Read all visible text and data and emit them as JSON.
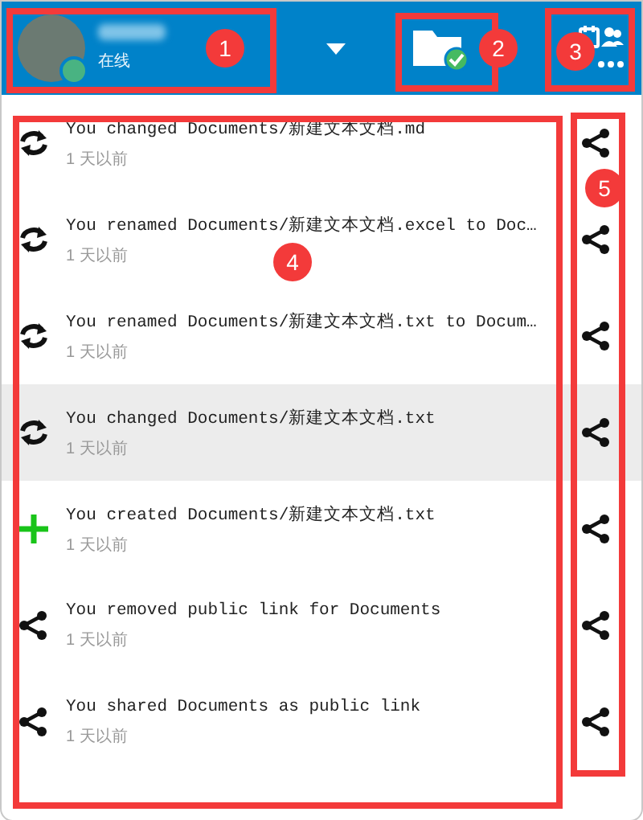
{
  "header": {
    "status": "在线"
  },
  "activities": [
    {
      "kind": "change",
      "message": "You changed Documents/新建文本文档.md",
      "time": "1 天以前",
      "selected": false
    },
    {
      "kind": "change",
      "message": "You renamed Documents/新建文本文档.excel to Doc…",
      "time": "1 天以前",
      "selected": false
    },
    {
      "kind": "change",
      "message": "You renamed Documents/新建文本文档.txt to Docum…",
      "time": "1 天以前",
      "selected": false
    },
    {
      "kind": "change",
      "message": "You changed Documents/新建文本文档.txt",
      "time": "1 天以前",
      "selected": true
    },
    {
      "kind": "create",
      "message": "You created Documents/新建文本文档.txt",
      "time": "1 天以前",
      "selected": false
    },
    {
      "kind": "share",
      "message": "You removed public link for Documents",
      "time": "1 天以前",
      "selected": false
    },
    {
      "kind": "share",
      "message": "You shared Documents as public link",
      "time": "1 天以前",
      "selected": false
    }
  ],
  "callouts": [
    {
      "label": "1"
    },
    {
      "label": "2"
    },
    {
      "label": "3"
    },
    {
      "label": "4"
    },
    {
      "label": "5"
    }
  ]
}
